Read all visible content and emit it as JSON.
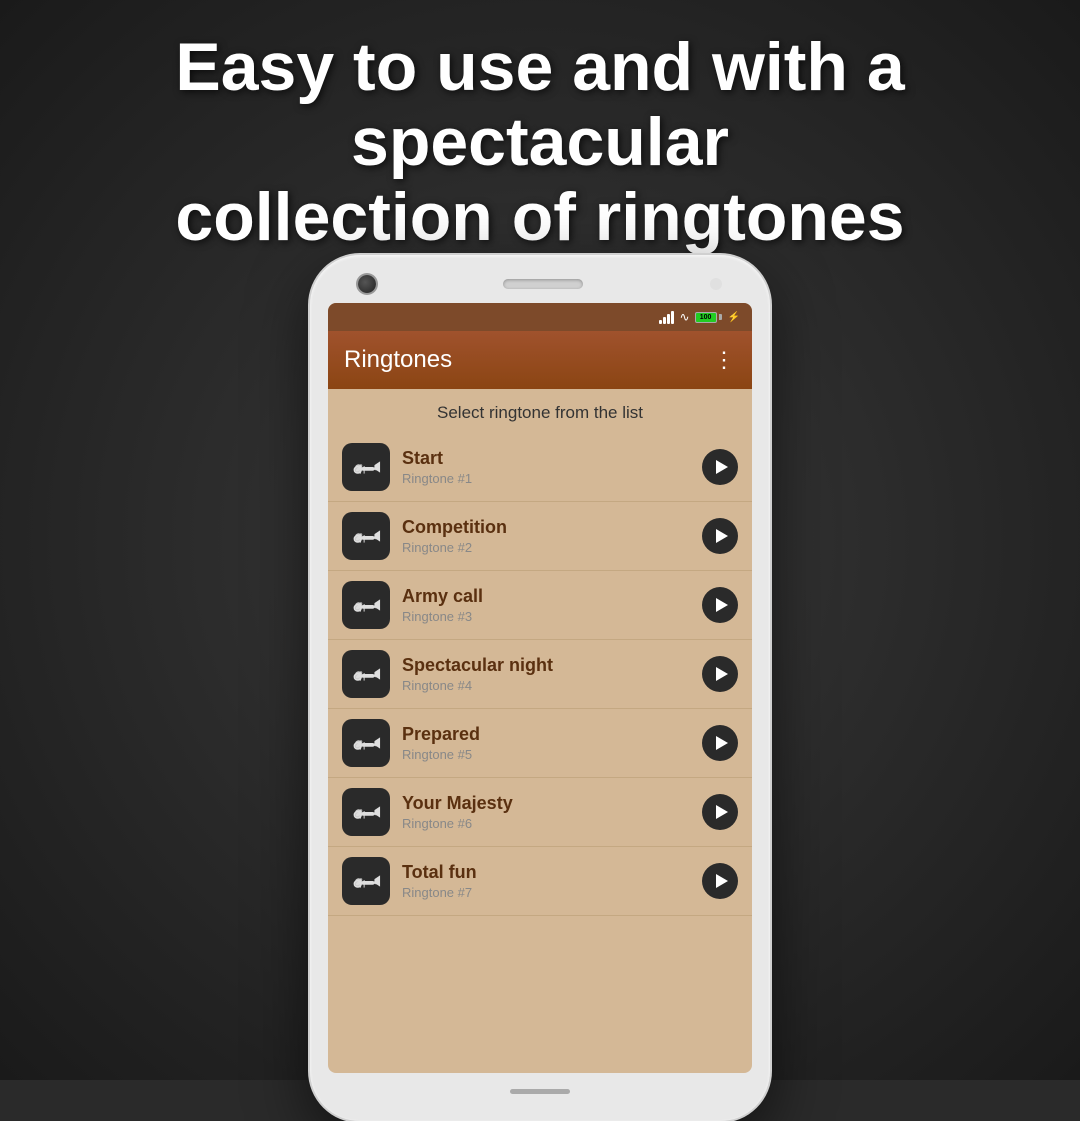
{
  "headline": {
    "line1": "Easy to use and with a spectacular",
    "line2": "collection of ringtones"
  },
  "app": {
    "title": "Ringtones",
    "select_prompt": "Select ringtone from the list",
    "menu_label": "⋮"
  },
  "status_bar": {
    "battery_text": "100"
  },
  "ringtones": [
    {
      "name": "Start",
      "number": "Ringtone #1"
    },
    {
      "name": "Competition",
      "number": "Ringtone #2"
    },
    {
      "name": "Army call",
      "number": "Ringtone #3"
    },
    {
      "name": "Spectacular night",
      "number": "Ringtone #4"
    },
    {
      "name": "Prepared",
      "number": "Ringtone #5"
    },
    {
      "name": "Your Majesty",
      "number": "Ringtone #6"
    },
    {
      "name": "Total fun",
      "number": "Ringtone #7"
    }
  ]
}
